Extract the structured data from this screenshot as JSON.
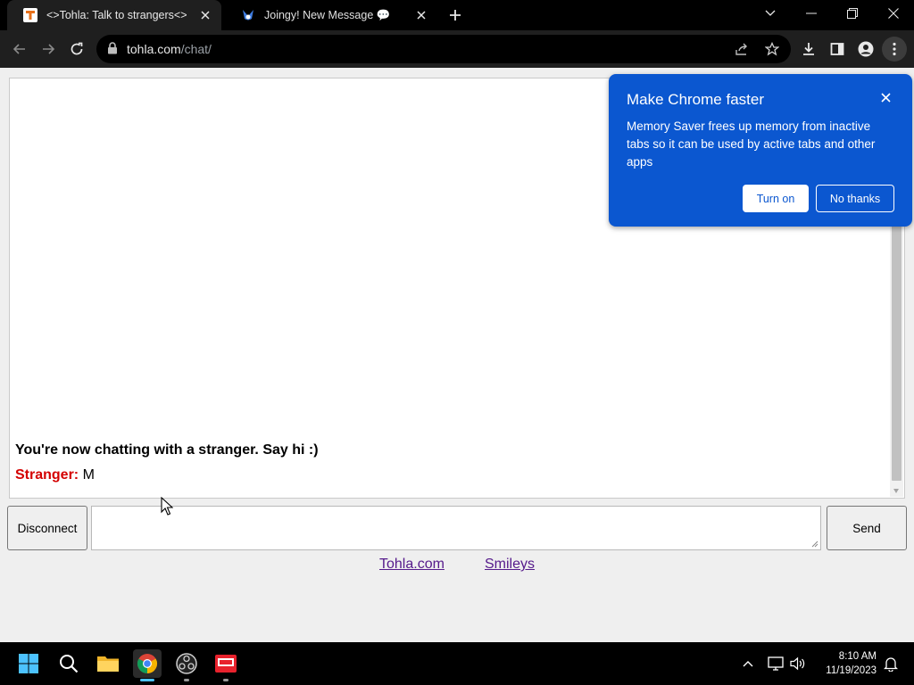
{
  "browser": {
    "tabs": [
      {
        "title": "<>Tohla: Talk to strangers<>",
        "active": true
      },
      {
        "title": "Joingy! New Message 💬",
        "active": false
      }
    ],
    "url_host": "tohla.com",
    "url_path": "/chat/"
  },
  "chat": {
    "status_message": "You're now chatting with a stranger. Say hi :)",
    "stranger_label": "Stranger:",
    "stranger_message": "M",
    "disconnect_label": "Disconnect",
    "send_label": "Send",
    "message_value": ""
  },
  "footer": {
    "links": [
      "Tohla.com",
      "Smileys"
    ]
  },
  "popup": {
    "title": "Make Chrome faster",
    "body": "Memory Saver frees up memory from inactive tabs so it can be used by active tabs and other apps",
    "turn_on_label": "Turn on",
    "no_thanks_label": "No thanks"
  },
  "taskbar": {
    "time": "8:10 AM",
    "date": "11/19/2023"
  },
  "colors": {
    "popup_bg": "#0b57d0",
    "stranger": "#d40000",
    "link_visited": "#551a8b"
  },
  "icons": [
    "tohla-favicon",
    "joingy-favicon",
    "close-icon",
    "plus-icon",
    "chevron-down-icon",
    "minimize-icon",
    "restore-icon",
    "back-arrow-icon",
    "forward-arrow-icon",
    "reload-icon",
    "lock-icon",
    "share-icon",
    "star-icon",
    "download-icon",
    "side-panel-icon",
    "profile-icon",
    "kebab-menu-icon",
    "windows-start-icon",
    "search-icon",
    "file-explorer-icon",
    "chrome-icon",
    "obs-icon",
    "red-app-icon",
    "chevron-up-icon",
    "network-icon",
    "volume-icon",
    "notification-bell-icon"
  ]
}
